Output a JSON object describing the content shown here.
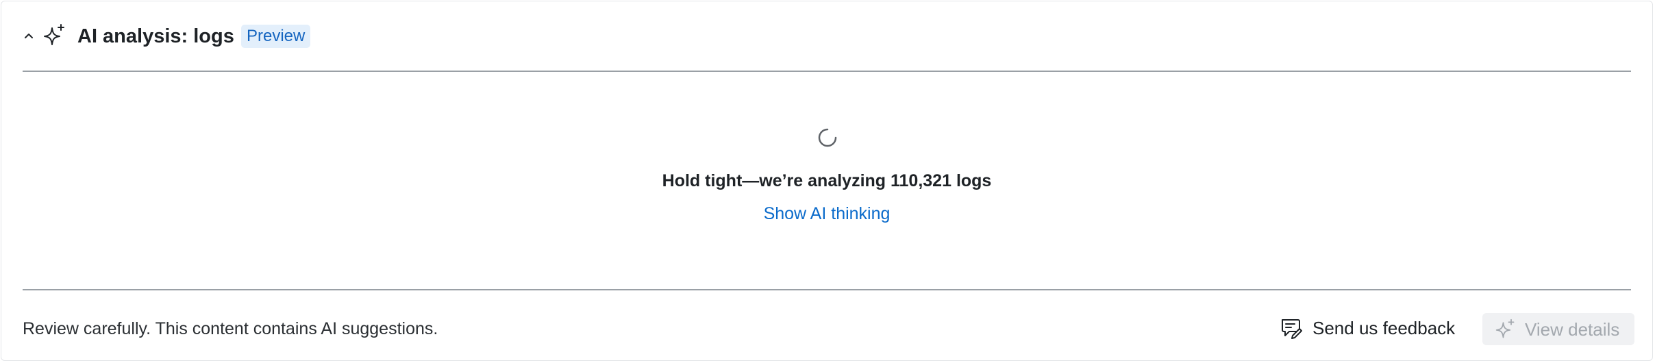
{
  "header": {
    "title": "AI analysis: logs",
    "badge": "Preview",
    "collapse_icon": "chevron-up-icon",
    "title_icon": "sparkle-icon"
  },
  "body": {
    "status": "Hold tight—we’re analyzing 110,321 logs",
    "link_label": "Show AI thinking",
    "spinner_icon": "loading-spinner-icon"
  },
  "footer": {
    "disclaimer": "Review carefully. This content contains AI suggestions.",
    "feedback_label": "Send us feedback",
    "feedback_icon": "feedback-icon",
    "details_label": "View details",
    "details_icon": "sparkle-icon",
    "details_disabled": true
  },
  "colors": {
    "link": "#0b6bcb",
    "badge_bg": "#e3effb",
    "badge_text": "#1565c0",
    "divider": "#9aa0a6",
    "disabled_text": "#a3a8ae",
    "disabled_bg": "#f0f1f3"
  }
}
